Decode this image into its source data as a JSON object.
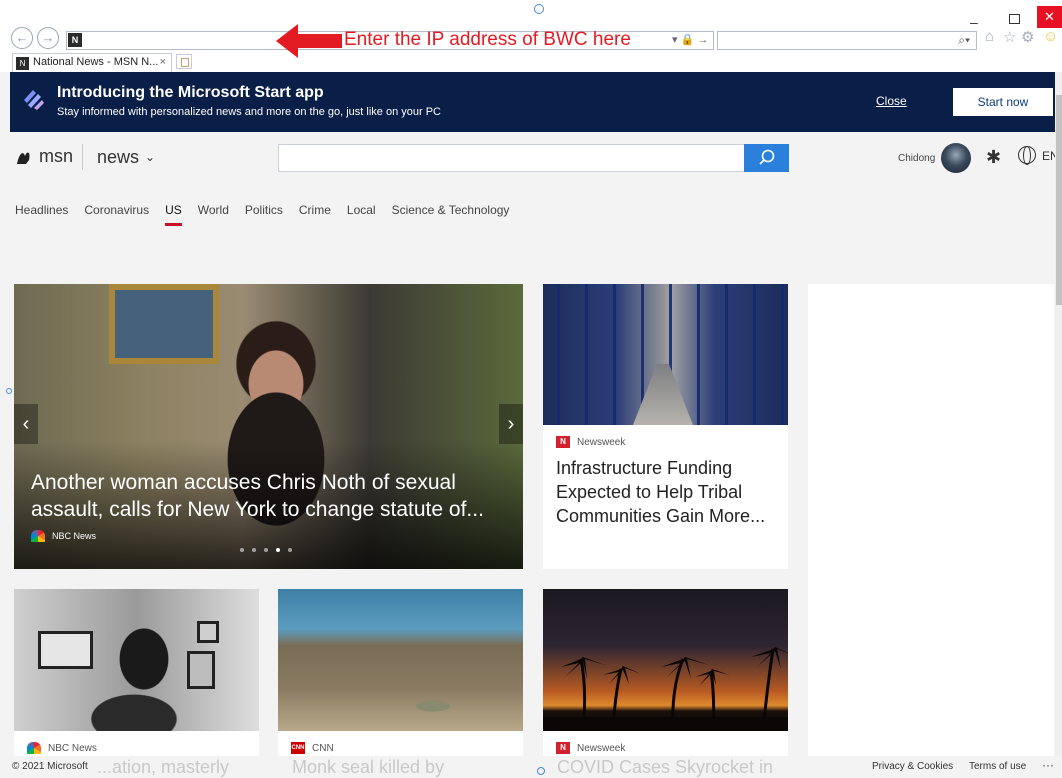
{
  "browser": {
    "tab_title": "National News - MSN N...",
    "tab_close": "×",
    "favicon_letter": "N",
    "address_tools": "▾ 🔒 →",
    "window_minimize": "–",
    "window_close": "✕"
  },
  "annotation": {
    "text": "Enter the IP address of BWC here",
    "color": "#e31b23"
  },
  "promo": {
    "title": "Introducing the Microsoft Start app",
    "subtitle": "Stay informed with personalized news and more on the go, just like on your PC",
    "close_label": "Close",
    "start_label": "Start now"
  },
  "header": {
    "logo_text": "msn",
    "section_name": "news",
    "search_placeholder": "",
    "user_name": "Chidong",
    "language": "EN"
  },
  "sections": [
    "Headlines",
    "Coronavirus",
    "US",
    "World",
    "Politics",
    "Crime",
    "Local",
    "Science & Technology"
  ],
  "active_section": "US",
  "hero": {
    "headline": "Another woman accuses Chris Noth of sexual assault, calls for New York to change statute of...",
    "source": "NBC News",
    "slide_count": 5,
    "active_slide": 4
  },
  "cards": [
    {
      "source": "Newsweek",
      "headline": "Infrastructure Funding Expected to Help Tribal Communities Gain More..."
    },
    {
      "source": "NBC News",
      "headline_peek": "...ation, masterly"
    },
    {
      "source": "CNN",
      "headline_peek": "Monk seal killed by"
    },
    {
      "source": "Newsweek",
      "headline_peek": "COVID Cases Skyrocket in"
    }
  ],
  "footer": {
    "copyright": "© 2021 Microsoft",
    "privacy": "Privacy & Cookies",
    "terms": "Terms of use",
    "more": "···"
  },
  "colors": {
    "promo_bg": "#0a1f47",
    "search_button": "#2a80db",
    "active_underline": "#c8102e",
    "window_close": "#e81123"
  }
}
